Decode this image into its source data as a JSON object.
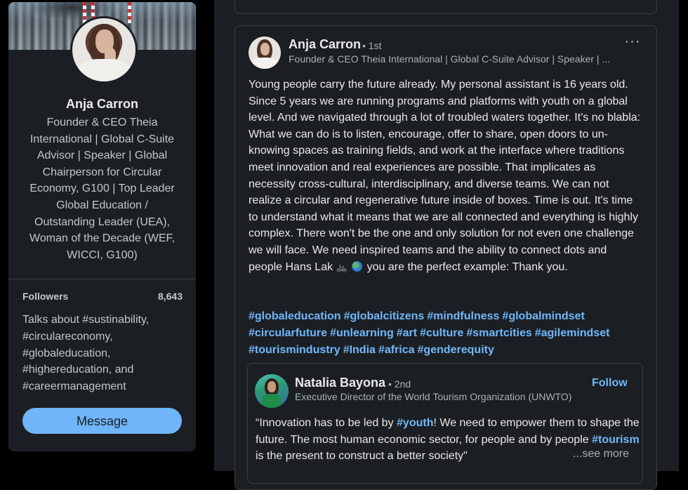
{
  "profile": {
    "name": "Anja Carron",
    "headline": "Founder & CEO Theia International | Global C-Suite Advisor | Speaker | Global Chairperson for Circular Economy, G100 | Top Leader Global Education / Outstanding Leader (UEA), Woman of the Decade (WEF, WICCI, G100)",
    "followers_label": "Followers",
    "followers_count": "8,643",
    "talks_about": "Talks about #sustinability, #circulareconomy, #globaleducation, #highereducation, and #careermanagement",
    "message_label": "Message"
  },
  "post": {
    "author_name": "Anja Carron",
    "author_degree": "• 1st",
    "author_headline": "Founder & CEO Theia International | Global C-Suite Advisor | Speaker | ...",
    "more_label": "···",
    "body_before_emoji": "Young people carry the future already. My personal assistant is 16 years old. Since 5 years we are running programs and platforms with youth on a global level. And we navigated through a lot of troubled waters together. It's no blabla: What we can do is to listen, encourage, offer to share, open doors to un-knowing spaces as training fields, and work at the interface where traditions meet innovation and real experiences are possible. That implicates as necessity cross-cultural, interdisciplinary, and diverse teams. We can not realize a circular and regenerative future inside of boxes. Time is out. It's time to understand what it means that we are all connected and everything is highly complex. There won't be the one and only solution for not even one challenge we will face. We need inspired teams and the ability to connect dots and people Hans Lak",
    "emoji_bike": "🚲",
    "body_after_emoji": "you are the perfect example: Thank you.",
    "hashtags": [
      "#globaleducation",
      "#globalcitizens",
      "#mindfulness",
      "#globalmindset",
      "#circularfuture",
      "#unlearning",
      "#art",
      "#culture",
      "#smartcities",
      "#agilemindset",
      "#tourismindustry",
      "#India",
      "#africa",
      "#genderequity"
    ]
  },
  "reshare": {
    "author_name": "Natalia Bayona",
    "author_degree": "• 2nd",
    "author_headline": "Executive Director of the World Tourism Organization (UNWTO)",
    "follow_label": "Follow",
    "text_1": "“Innovation has to be led by ",
    "tag_1": "#youth",
    "text_2": "! We need to empower them to shape the future. The most human economic sector, for people and by people ",
    "tag_2": "#tourism",
    "text_3": " is the present to construct a better society\"",
    "see_more": "...see more"
  },
  "colors": {
    "page_bg": "#000000",
    "card_bg": "#1b1f23",
    "link": "#71b7fb",
    "button": "#70b5f9"
  }
}
